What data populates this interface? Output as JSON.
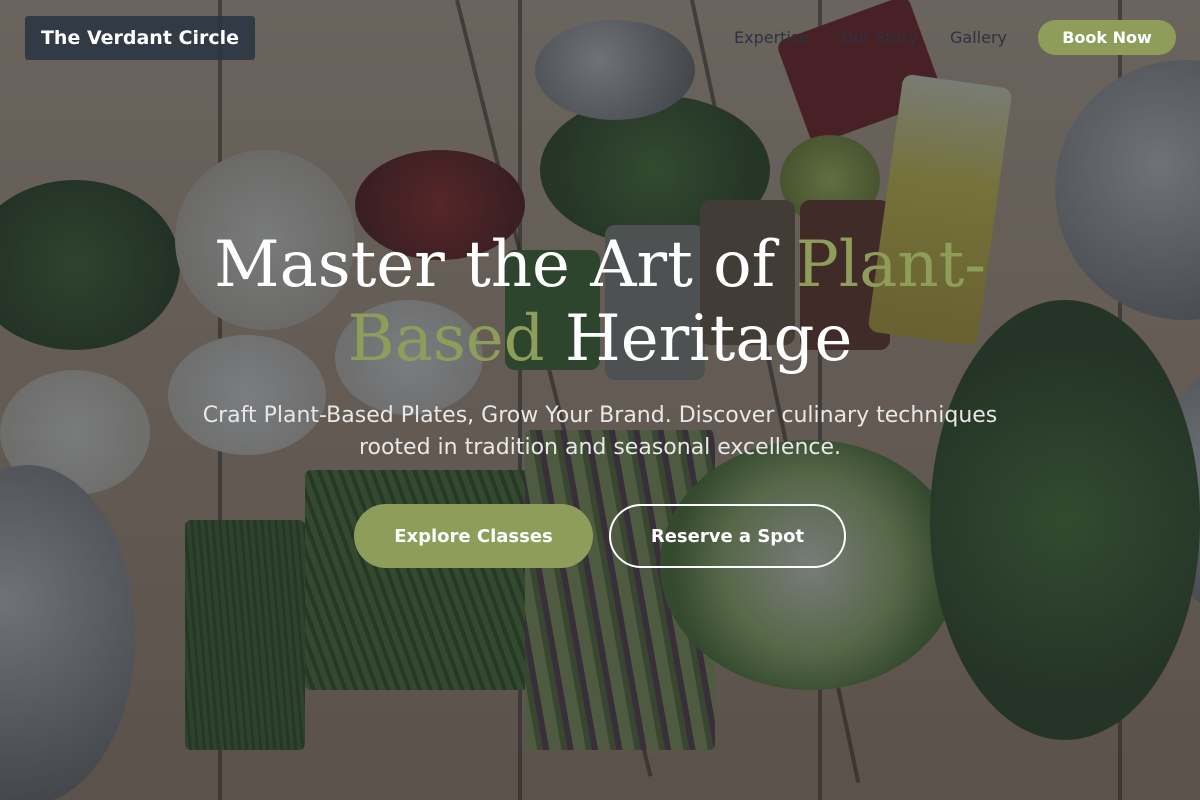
{
  "brand": {
    "name": "The Verdant Circle"
  },
  "nav": {
    "links": [
      "Expertise",
      "Our Story",
      "Gallery"
    ],
    "cta": "Book Now"
  },
  "hero": {
    "title_part1": "Master the Art of ",
    "title_accent": "Plant-Based",
    "title_part2": " Heritage",
    "subtitle": "Craft Plant-Based Plates, Grow Your Brand. Discover culinary techniques rooted in tradition and seasonal excellence.",
    "primary_button": "Explore Classes",
    "secondary_button": "Reserve a Spot"
  },
  "colors": {
    "accent": "#8e9e5a",
    "overlay": "#222830",
    "brand_box": "#2a3442"
  }
}
